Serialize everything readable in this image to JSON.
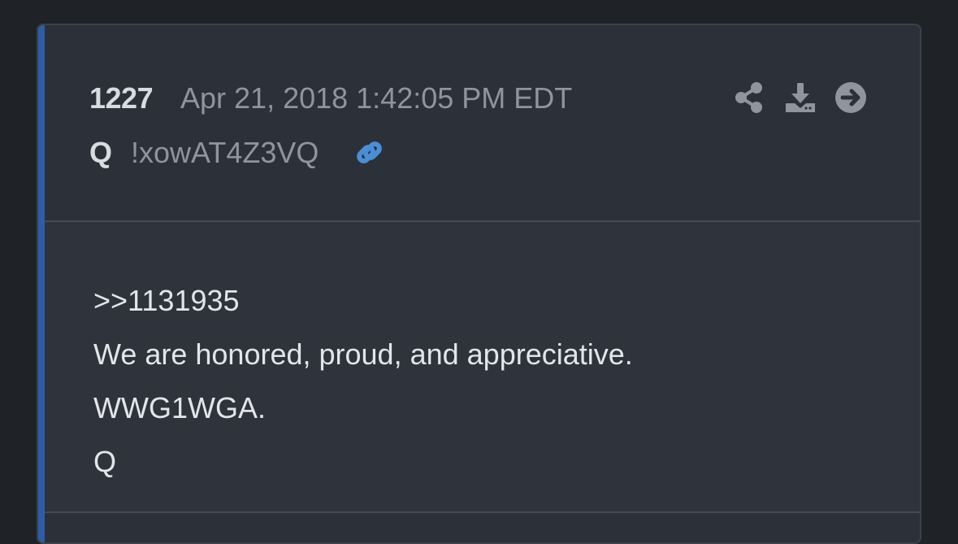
{
  "post": {
    "number": "1227",
    "timestamp": "Apr 21, 2018 1:42:05 PM EDT",
    "author": "Q",
    "tripcode": "!xowAT4Z3VQ",
    "body_lines": [
      ">>1131935",
      "We are honored, proud, and appreciative.",
      "WWG1WGA.",
      "Q"
    ]
  },
  "icons": {
    "link": "link-icon",
    "share": "share-icon",
    "download": "download-icon",
    "goto": "arrow-right-circle-icon"
  },
  "colors": {
    "accent": "#2d5da8",
    "link_icon": "#4a8fd6",
    "muted_icon": "#8f949e",
    "card_background": "#2c3038"
  }
}
